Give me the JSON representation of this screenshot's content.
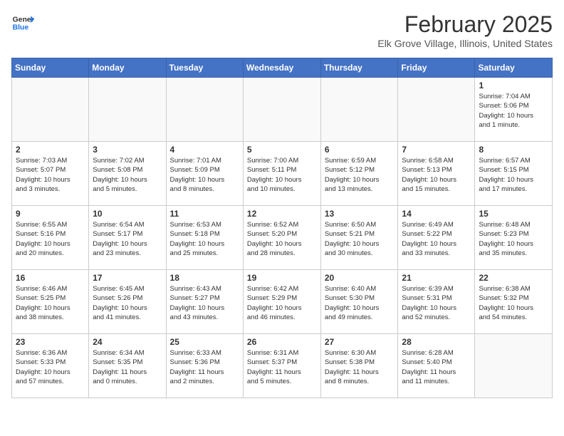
{
  "logo": {
    "line1": "General",
    "line2": "Blue"
  },
  "title": "February 2025",
  "location": "Elk Grove Village, Illinois, United States",
  "weekdays": [
    "Sunday",
    "Monday",
    "Tuesday",
    "Wednesday",
    "Thursday",
    "Friday",
    "Saturday"
  ],
  "weeks": [
    [
      {
        "day": "",
        "info": ""
      },
      {
        "day": "",
        "info": ""
      },
      {
        "day": "",
        "info": ""
      },
      {
        "day": "",
        "info": ""
      },
      {
        "day": "",
        "info": ""
      },
      {
        "day": "",
        "info": ""
      },
      {
        "day": "1",
        "info": "Sunrise: 7:04 AM\nSunset: 5:06 PM\nDaylight: 10 hours\nand 1 minute."
      }
    ],
    [
      {
        "day": "2",
        "info": "Sunrise: 7:03 AM\nSunset: 5:07 PM\nDaylight: 10 hours\nand 3 minutes."
      },
      {
        "day": "3",
        "info": "Sunrise: 7:02 AM\nSunset: 5:08 PM\nDaylight: 10 hours\nand 5 minutes."
      },
      {
        "day": "4",
        "info": "Sunrise: 7:01 AM\nSunset: 5:09 PM\nDaylight: 10 hours\nand 8 minutes."
      },
      {
        "day": "5",
        "info": "Sunrise: 7:00 AM\nSunset: 5:11 PM\nDaylight: 10 hours\nand 10 minutes."
      },
      {
        "day": "6",
        "info": "Sunrise: 6:59 AM\nSunset: 5:12 PM\nDaylight: 10 hours\nand 13 minutes."
      },
      {
        "day": "7",
        "info": "Sunrise: 6:58 AM\nSunset: 5:13 PM\nDaylight: 10 hours\nand 15 minutes."
      },
      {
        "day": "8",
        "info": "Sunrise: 6:57 AM\nSunset: 5:15 PM\nDaylight: 10 hours\nand 17 minutes."
      }
    ],
    [
      {
        "day": "9",
        "info": "Sunrise: 6:55 AM\nSunset: 5:16 PM\nDaylight: 10 hours\nand 20 minutes."
      },
      {
        "day": "10",
        "info": "Sunrise: 6:54 AM\nSunset: 5:17 PM\nDaylight: 10 hours\nand 23 minutes."
      },
      {
        "day": "11",
        "info": "Sunrise: 6:53 AM\nSunset: 5:18 PM\nDaylight: 10 hours\nand 25 minutes."
      },
      {
        "day": "12",
        "info": "Sunrise: 6:52 AM\nSunset: 5:20 PM\nDaylight: 10 hours\nand 28 minutes."
      },
      {
        "day": "13",
        "info": "Sunrise: 6:50 AM\nSunset: 5:21 PM\nDaylight: 10 hours\nand 30 minutes."
      },
      {
        "day": "14",
        "info": "Sunrise: 6:49 AM\nSunset: 5:22 PM\nDaylight: 10 hours\nand 33 minutes."
      },
      {
        "day": "15",
        "info": "Sunrise: 6:48 AM\nSunset: 5:23 PM\nDaylight: 10 hours\nand 35 minutes."
      }
    ],
    [
      {
        "day": "16",
        "info": "Sunrise: 6:46 AM\nSunset: 5:25 PM\nDaylight: 10 hours\nand 38 minutes."
      },
      {
        "day": "17",
        "info": "Sunrise: 6:45 AM\nSunset: 5:26 PM\nDaylight: 10 hours\nand 41 minutes."
      },
      {
        "day": "18",
        "info": "Sunrise: 6:43 AM\nSunset: 5:27 PM\nDaylight: 10 hours\nand 43 minutes."
      },
      {
        "day": "19",
        "info": "Sunrise: 6:42 AM\nSunset: 5:29 PM\nDaylight: 10 hours\nand 46 minutes."
      },
      {
        "day": "20",
        "info": "Sunrise: 6:40 AM\nSunset: 5:30 PM\nDaylight: 10 hours\nand 49 minutes."
      },
      {
        "day": "21",
        "info": "Sunrise: 6:39 AM\nSunset: 5:31 PM\nDaylight: 10 hours\nand 52 minutes."
      },
      {
        "day": "22",
        "info": "Sunrise: 6:38 AM\nSunset: 5:32 PM\nDaylight: 10 hours\nand 54 minutes."
      }
    ],
    [
      {
        "day": "23",
        "info": "Sunrise: 6:36 AM\nSunset: 5:33 PM\nDaylight: 10 hours\nand 57 minutes."
      },
      {
        "day": "24",
        "info": "Sunrise: 6:34 AM\nSunset: 5:35 PM\nDaylight: 11 hours\nand 0 minutes."
      },
      {
        "day": "25",
        "info": "Sunrise: 6:33 AM\nSunset: 5:36 PM\nDaylight: 11 hours\nand 2 minutes."
      },
      {
        "day": "26",
        "info": "Sunrise: 6:31 AM\nSunset: 5:37 PM\nDaylight: 11 hours\nand 5 minutes."
      },
      {
        "day": "27",
        "info": "Sunrise: 6:30 AM\nSunset: 5:38 PM\nDaylight: 11 hours\nand 8 minutes."
      },
      {
        "day": "28",
        "info": "Sunrise: 6:28 AM\nSunset: 5:40 PM\nDaylight: 11 hours\nand 11 minutes."
      },
      {
        "day": "",
        "info": ""
      }
    ]
  ]
}
